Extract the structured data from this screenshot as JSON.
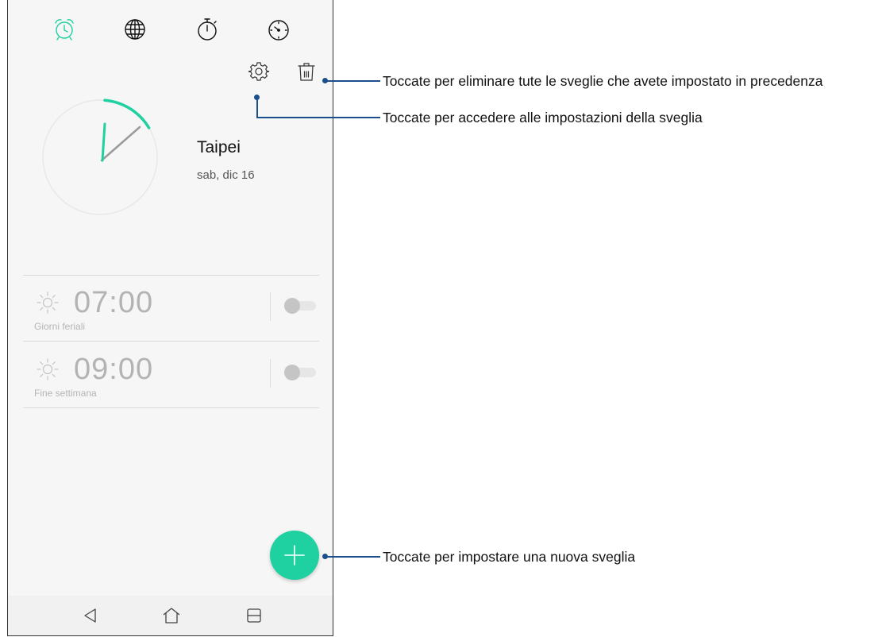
{
  "tabs": [
    {
      "name": "alarm-clock-icon",
      "active": true
    },
    {
      "name": "globe-icon",
      "active": false
    },
    {
      "name": "stopwatch-icon",
      "active": false
    },
    {
      "name": "timer-icon",
      "active": false
    }
  ],
  "toolbar": {
    "settings_icon": "gear-icon",
    "delete_icon": "trash-icon"
  },
  "clock": {
    "city": "Taipei",
    "date": "sab, dic 16"
  },
  "alarms": [
    {
      "time": "07:00",
      "label": "Giorni feriali",
      "enabled": false,
      "icon": "sun-icon"
    },
    {
      "time": "09:00",
      "label": "Fine settimana",
      "enabled": false,
      "icon": "sun-icon"
    }
  ],
  "fab": {
    "icon": "plus-icon"
  },
  "nav": [
    {
      "icon": "back-icon"
    },
    {
      "icon": "home-icon"
    },
    {
      "icon": "recents-icon"
    }
  ],
  "annotations": {
    "delete": "Toccate per eliminare tute le sveglie che avete impostato in precedenza",
    "settings": "Toccate per accedere alle impostazioni della sveglia",
    "add": "Toccate per impostare una nuova sveglia"
  },
  "colors": {
    "accent": "#1fd0a1",
    "callout": "#1b4f8c"
  }
}
